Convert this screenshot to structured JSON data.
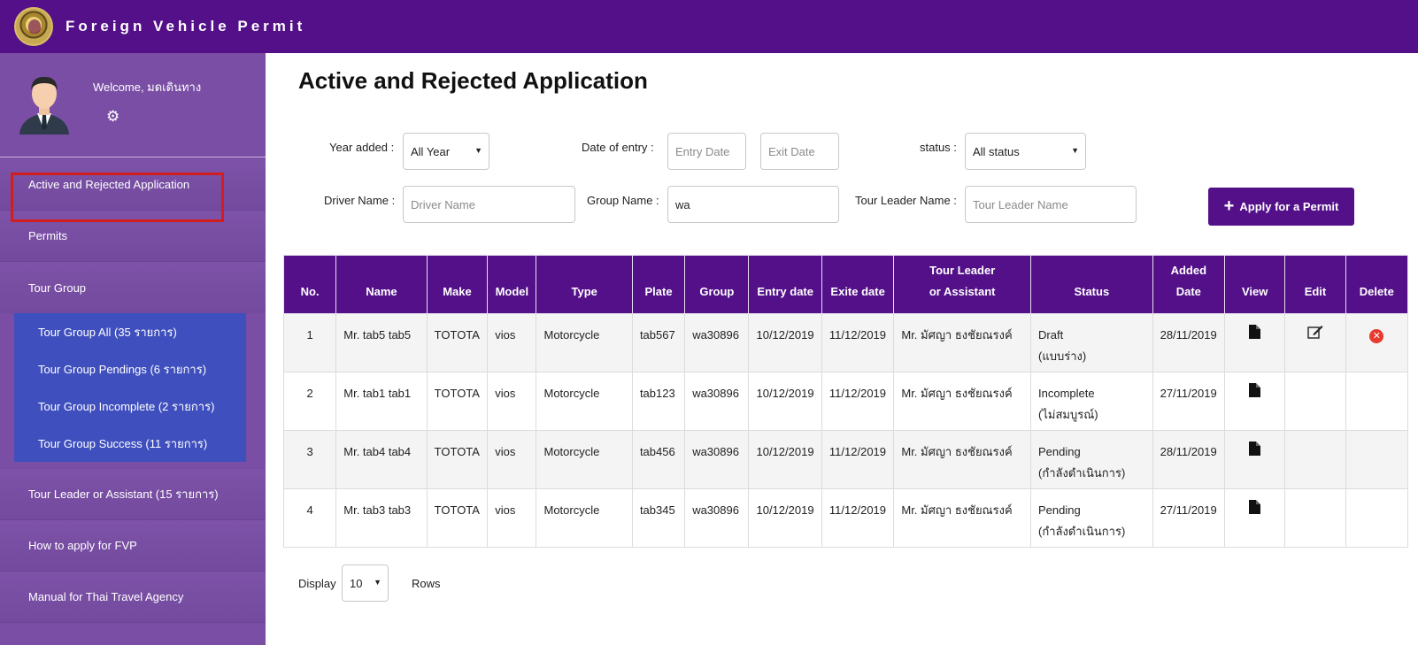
{
  "header": {
    "title": "Foreign Vehicle Permit"
  },
  "user": {
    "welcome": "Welcome, มดเดินทาง"
  },
  "sidebar": {
    "items": [
      {
        "label": "Active and Rejected Application"
      },
      {
        "label": "Permits"
      },
      {
        "label": "Tour Group"
      }
    ],
    "tour_group_sub": [
      {
        "label": "Tour Group All (35 รายการ)"
      },
      {
        "label": "Tour Group Pendings (6 รายการ)"
      },
      {
        "label": "Tour Group Incomplete (2 รายการ)"
      },
      {
        "label": "Tour Group Success (11 รายการ)"
      }
    ],
    "items_after": [
      {
        "label": "Tour Leader or Assistant (15 รายการ)"
      },
      {
        "label": "How to apply for FVP"
      },
      {
        "label": "Manual for Thai Travel Agency"
      }
    ]
  },
  "page": {
    "title": "Active and Rejected Application"
  },
  "filters": {
    "year_label": "Year added :",
    "year_value": "All Year",
    "date_label": "Date of entry :",
    "entry_placeholder": "Entry Date",
    "exit_placeholder": "Exit Date",
    "status_label": "status :",
    "status_value": "All status",
    "driver_label": "Driver Name :",
    "driver_placeholder": "Driver Name",
    "group_label": "Group Name :",
    "group_value": "wa",
    "leader_label": "Tour Leader Name :",
    "leader_placeholder": "Tour Leader Name",
    "apply_button": "Apply for a Permit"
  },
  "table": {
    "headers": {
      "no": "No.",
      "name": "Name",
      "make": "Make",
      "model": "Model",
      "type": "Type",
      "plate": "Plate",
      "group": "Group",
      "entry": "Entry date",
      "exit": "Exite date",
      "leader_1": "Tour Leader",
      "leader_2": "or Assistant",
      "status": "Status",
      "added_1": "Added",
      "added_2": "Date",
      "view": "View",
      "edit": "Edit",
      "delete": "Delete"
    },
    "rows": [
      {
        "no": "1",
        "name": "Mr. tab5 tab5",
        "make": "TOTOTA",
        "model": "vios",
        "type": "Motorcycle",
        "plate": "tab567",
        "group": "wa30896",
        "entry": "10/12/2019",
        "exit": "11/12/2019",
        "leader": "Mr. มัศญา ธงชัยณรงค์",
        "status": "Draft",
        "status_th": "(แบบร่าง)",
        "added": "28/11/2019"
      },
      {
        "no": "2",
        "name": "Mr. tab1 tab1",
        "make": "TOTOTA",
        "model": "vios",
        "type": "Motorcycle",
        "plate": "tab123",
        "group": "wa30896",
        "entry": "10/12/2019",
        "exit": "11/12/2019",
        "leader": "Mr. มัศญา ธงชัยณรงค์",
        "status": "Incomplete",
        "status_th": "(ไม่สมบูรณ์)",
        "added": "27/11/2019"
      },
      {
        "no": "3",
        "name": "Mr. tab4 tab4",
        "make": "TOTOTA",
        "model": "vios",
        "type": "Motorcycle",
        "plate": "tab456",
        "group": "wa30896",
        "entry": "10/12/2019",
        "exit": "11/12/2019",
        "leader": "Mr. มัศญา ธงชัยณรงค์",
        "status": "Pending",
        "status_th": "(กำลังดำเนินการ)",
        "added": "28/11/2019"
      },
      {
        "no": "4",
        "name": "Mr. tab3 tab3",
        "make": "TOTOTA",
        "model": "vios",
        "type": "Motorcycle",
        "plate": "tab345",
        "group": "wa30896",
        "entry": "10/12/2019",
        "exit": "11/12/2019",
        "leader": "Mr. มัศญา ธงชัยณรงค์",
        "status": "Pending",
        "status_th": "(กำลังดำเนินการ)",
        "added": "27/11/2019"
      }
    ]
  },
  "pagination": {
    "display_label": "Display",
    "rows_value": "10",
    "rows_label": "Rows"
  },
  "colors": {
    "brand": "#531088",
    "sidebar": "#7a4ea5",
    "submenu": "#3f4fbd",
    "highlight": "#d11d1d"
  }
}
